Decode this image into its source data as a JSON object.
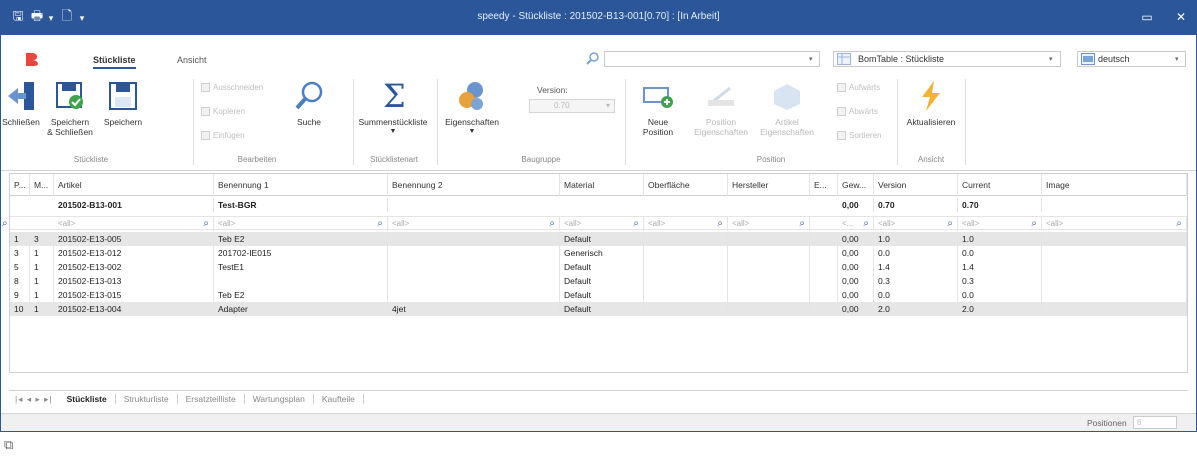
{
  "window": {
    "title": "speedy - Stückliste : 201502-B13-001[0.70] : [In Arbeit]",
    "controls": {
      "minimize": "▭",
      "close": "✕"
    }
  },
  "quick_access": {
    "save": "🖫",
    "print": "🖶",
    "new": "🗋",
    "arrow": "▾"
  },
  "ribbon_tabs": [
    {
      "label": "Stückliste",
      "active": true
    },
    {
      "label": "Ansicht",
      "active": false
    }
  ],
  "top_controls": {
    "search_value": "",
    "bomtable_value": "BomTable : Stückliste",
    "language_value": "deutsch"
  },
  "ribbon": {
    "close": "Schließen",
    "save_close": "Speichern\n& Schließen",
    "save": "Speichern",
    "group_stueckliste": "Stückliste",
    "cut": "Ausschneiden",
    "copy": "Kopieren",
    "paste": "Einfügen",
    "search": "Suche",
    "group_bearbeiten": "Bearbeiten",
    "summen": "Summenstückliste",
    "group_art": "Stücklistenart",
    "eigenschaften": "Eigenschaften",
    "version_label": "Version:",
    "version_value": "0.70",
    "group_baugruppe": "Baugruppe",
    "neue_position": "Neue\nPosition",
    "position_eig": "Position\nEigenschaften",
    "artikel_eig": "Artikel\nEigenschaften",
    "aufwaerts": "Aufwärts",
    "abwaerts": "Abwärts",
    "sortieren": "Sortieren",
    "group_position": "Position",
    "aktualisieren": "Aktualisieren",
    "group_ansicht": "Ansicht"
  },
  "grid": {
    "columns": [
      "P...",
      "M...",
      "Artikel",
      "Benennung 1",
      "Benennung 2",
      "Material",
      "Oberfläche",
      "Hersteller",
      "E...",
      "Gew...",
      "Version",
      "Current",
      "Image"
    ],
    "summary": {
      "artikel": "201502-B13-001",
      "benennung1": "Test-BGR",
      "gew": "0,00",
      "version": "0.70",
      "current": "0.70"
    },
    "filter_placeholder": "<all>",
    "filter_short": "<...",
    "rows": [
      {
        "p": "1",
        "m": "3",
        "artikel": "201502-E13-005",
        "ben1": "Teb E2",
        "ben2": "",
        "material": "Default",
        "gew": "0,00",
        "version": "1.0",
        "current": "1.0",
        "highlight": true
      },
      {
        "p": "3",
        "m": "1",
        "artikel": "201502-E13-012",
        "ben1": "201702-IE015",
        "ben2": "",
        "material": "Generisch",
        "gew": "0,00",
        "version": "0.0",
        "current": "0.0",
        "highlight": false
      },
      {
        "p": "5",
        "m": "1",
        "artikel": "201502-E13-002",
        "ben1": "TestE1",
        "ben2": "",
        "material": "Default",
        "gew": "0,00",
        "version": "1.4",
        "current": "1.4",
        "highlight": false
      },
      {
        "p": "8",
        "m": "1",
        "artikel": "201502-E13-013",
        "ben1": "",
        "ben2": "",
        "material": "Default",
        "gew": "0,00",
        "version": "0.3",
        "current": "0.3",
        "highlight": false
      },
      {
        "p": "9",
        "m": "1",
        "artikel": "201502-E13-015",
        "ben1": "Teb E2",
        "ben2": "",
        "material": "Default",
        "gew": "0,00",
        "version": "0.0",
        "current": "0.0",
        "highlight": false
      },
      {
        "p": "10",
        "m": "1",
        "artikel": "201502-E13-004",
        "ben1": "Adapter",
        "ben2": "4jet",
        "material": "Default",
        "gew": "0,00",
        "version": "2.0",
        "current": "2.0",
        "highlight": true
      }
    ]
  },
  "sheet_nav": "|◂ ◂ ▸ ▸|",
  "sheet_tabs": [
    {
      "label": "Stückliste",
      "active": true
    },
    {
      "label": "Strukturliste",
      "active": false
    },
    {
      "label": "Ersatzteilliste",
      "active": false
    },
    {
      "label": "Wartungsplan",
      "active": false
    },
    {
      "label": "Kaufteile",
      "active": false
    }
  ],
  "status": {
    "positions_label": "Positionen",
    "positions_value": "6"
  },
  "colors": {
    "accent": "#2b579a",
    "highlight_row": "#e6e6e6"
  }
}
